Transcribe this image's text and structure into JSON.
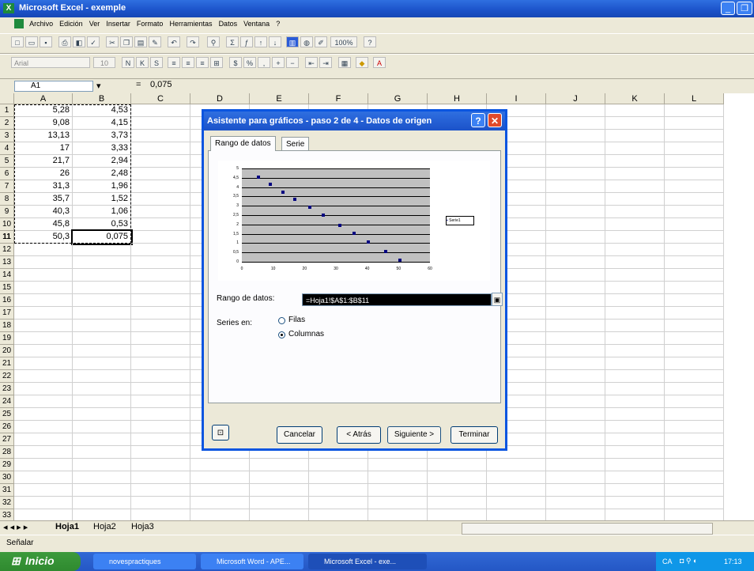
{
  "app": {
    "title": "Microsoft Excel - exemple",
    "icon": "excel-icon"
  },
  "window_buttons": {
    "minimize": "_",
    "restore": "❐",
    "close": "✕"
  },
  "menu": [
    "Archivo",
    "Edición",
    "Ver",
    "Insertar",
    "Formato",
    "Herramientas",
    "Datos",
    "Ventana",
    "?"
  ],
  "toolbar": {
    "zoom": "100%",
    "font": "Arial",
    "size": "10"
  },
  "formula_bar": {
    "name_box": "A1",
    "fx": "=",
    "value": "0,075"
  },
  "columns": [
    "A",
    "B",
    "C",
    "D",
    "E",
    "F",
    "G",
    "H",
    "I",
    "J",
    "K",
    "L"
  ],
  "rows": [
    "1",
    "2",
    "3",
    "4",
    "5",
    "6",
    "7",
    "8",
    "9",
    "10",
    "11",
    "12",
    "13",
    "14",
    "15",
    "16",
    "17",
    "18",
    "19",
    "20",
    "21",
    "22",
    "23",
    "24",
    "25",
    "26",
    "27",
    "28",
    "29",
    "30",
    "31",
    "32",
    "33"
  ],
  "cells": {
    "A": [
      "5,28",
      "9,08",
      "13,13",
      "17",
      "21,7",
      "26",
      "31,3",
      "35,7",
      "40,3",
      "45,8",
      "50,3"
    ],
    "B": [
      "4,53",
      "4,15",
      "3,73",
      "3,33",
      "2,94",
      "2,48",
      "1,96",
      "1,52",
      "1,06",
      "0,53",
      "0,075"
    ]
  },
  "sheet_tabs": [
    "Hoja1",
    "Hoja2",
    "Hoja3"
  ],
  "status": "Señalar",
  "dialog": {
    "title": "Asistente para gráficos - paso 2 de 4 - Datos de origen",
    "help": "?",
    "close": "✕",
    "tabs": [
      "Rango de datos",
      "Serie"
    ],
    "range_label": "Rango de datos:",
    "range_value": "=Hoja1!$A$1:$B$11",
    "series_label": "Series en:",
    "opt_rows": "Filas",
    "opt_cols": "Columnas",
    "btn_cancel": "Cancelar",
    "btn_back": "< Atrás",
    "btn_next": "Siguiente >",
    "btn_finish": "Terminar"
  },
  "chart_data": {
    "type": "scatter",
    "x": [
      5.28,
      9.08,
      13.13,
      17,
      21.7,
      26,
      31.3,
      35.7,
      40.3,
      45.8,
      50.3
    ],
    "y": [
      4.53,
      4.15,
      3.73,
      3.33,
      2.94,
      2.48,
      1.96,
      1.52,
      1.06,
      0.53,
      0.075
    ],
    "xlim": [
      0,
      60
    ],
    "ylim": [
      0,
      5
    ],
    "xticks": [
      "0",
      "10",
      "20",
      "30",
      "40",
      "50",
      "60"
    ],
    "yticks": [
      "5",
      "4,5",
      "4",
      "3,5",
      "3",
      "2,5",
      "2",
      "1,5",
      "1",
      "0,5",
      "0"
    ],
    "legend": "Serie1",
    "grid": true,
    "legend_position": "right"
  },
  "taskbar": {
    "start": "Inicio",
    "items": [
      "novespractiques",
      "Microsoft Word - APE...",
      "Microsoft Excel - exe..."
    ],
    "tray": "CA",
    "clock": "17:13"
  }
}
